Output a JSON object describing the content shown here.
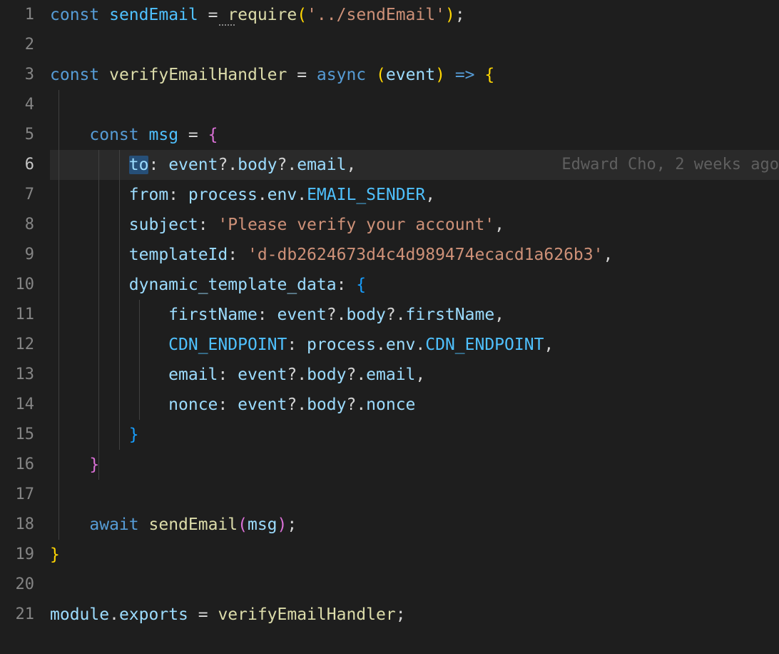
{
  "gutter": {
    "lines": [
      "1",
      "2",
      "3",
      "4",
      "5",
      "6",
      "7",
      "8",
      "9",
      "10",
      "11",
      "12",
      "13",
      "14",
      "15",
      "16",
      "17",
      "18",
      "19",
      "20",
      "21"
    ],
    "current": 6
  },
  "blame": {
    "author": "Edward Cho",
    "when": "2 weeks ago"
  },
  "code": {
    "l1": {
      "const": "const",
      "sendEmail": "sendEmail",
      "eq": " = ",
      "require": "require",
      "lp": "(",
      "path": "'../sendEmail'",
      "rp": ")",
      "semi": ";"
    },
    "l3": {
      "const": "const",
      "name": "verifyEmailHandler",
      "eq": " = ",
      "async": "async",
      "lp": "(",
      "event": "event",
      "rp": ")",
      "arrow": " => ",
      "brace": "{"
    },
    "l5": {
      "const": "const",
      "msg": "msg",
      "eq": " = ",
      "brace": "{"
    },
    "l6": {
      "to": "to",
      "colon": ": ",
      "event": "event",
      "q1": "?.",
      "body": "body",
      "q2": "?.",
      "email": "email",
      "comma": ","
    },
    "l7": {
      "from": "from",
      "colon": ": ",
      "process": "process",
      "dot1": ".",
      "env": "env",
      "dot2": ".",
      "sender": "EMAIL_SENDER",
      "comma": ","
    },
    "l8": {
      "subject": "subject",
      "colon": ": ",
      "str": "'Please verify your account'",
      "comma": ","
    },
    "l9": {
      "templateId": "templateId",
      "colon": ": ",
      "str": "'d-db2624673d4c4d989474ecacd1a626b3'",
      "comma": ","
    },
    "l10": {
      "dtd": "dynamic_template_data",
      "colon": ": ",
      "brace": "{"
    },
    "l11": {
      "firstName": "firstName",
      "colon": ": ",
      "event": "event",
      "q1": "?.",
      "body": "body",
      "q2": "?.",
      "fn": "firstName",
      "comma": ","
    },
    "l12": {
      "cdn": "CDN_ENDPOINT",
      "colon": ": ",
      "process": "process",
      "dot1": ".",
      "env": "env",
      "dot2": ".",
      "ep": "CDN_ENDPOINT",
      "comma": ","
    },
    "l13": {
      "email": "email",
      "colon": ": ",
      "event": "event",
      "q1": "?.",
      "body": "body",
      "q2": "?.",
      "em": "email",
      "comma": ","
    },
    "l14": {
      "nonce": "nonce",
      "colon": ": ",
      "event": "event",
      "q1": "?.",
      "body": "body",
      "q2": "?.",
      "nc": "nonce"
    },
    "l15": {
      "brace": "}"
    },
    "l16": {
      "brace": "}"
    },
    "l18": {
      "await": "await",
      "sendEmail": "sendEmail",
      "lp": "(",
      "msg": "msg",
      "rp": ")",
      "semi": ";"
    },
    "l19": {
      "brace": "}"
    },
    "l21": {
      "module": "module",
      "dot": ".",
      "exports": "exports",
      "eq": " = ",
      "name": "verifyEmailHandler",
      "semi": ";"
    }
  }
}
